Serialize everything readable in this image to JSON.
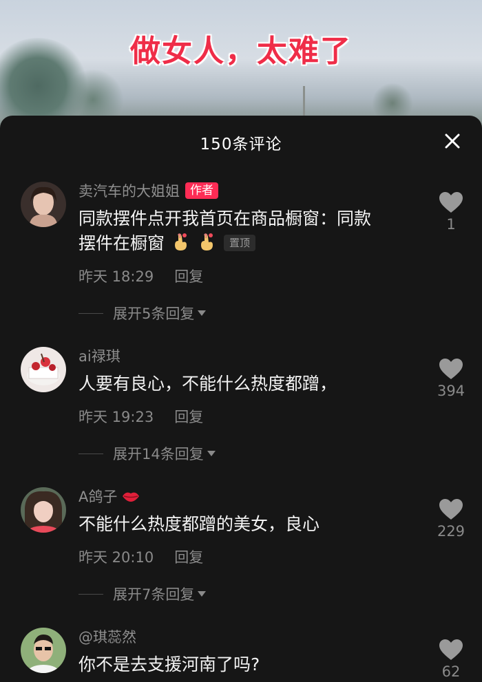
{
  "video": {
    "caption": "做女人，太难了"
  },
  "comments_panel": {
    "title": "150条评论"
  },
  "comments": [
    {
      "author": "卖汽车的大姐姐",
      "badge": "作者",
      "text_line1": "同款摆件点开我首页在商品橱窗：同款",
      "text_line2": "摆件在橱窗",
      "pinned_label": "置顶",
      "time": "昨天 18:29",
      "reply_label": "回复",
      "expand_label": "展开5条回复",
      "likes": "1"
    },
    {
      "author": "ai禄琪",
      "text_line1": "人要有良心，不能什么热度都蹭，",
      "time": "昨天 19:23",
      "reply_label": "回复",
      "expand_label": "展开14条回复",
      "likes": "394"
    },
    {
      "author": "A鸽子",
      "text_line1": "不能什么热度都蹭的美女，良心",
      "time": "昨天 20:10",
      "reply_label": "回复",
      "expand_label": "展开7条回复",
      "likes": "229"
    },
    {
      "author": "@琪蕊然",
      "text_line1": "你不是去支援河南了吗?",
      "likes": "62"
    }
  ],
  "colors": {
    "background": "#161616",
    "accent": "#fe2c55",
    "caption_red": "#ef2d48"
  }
}
